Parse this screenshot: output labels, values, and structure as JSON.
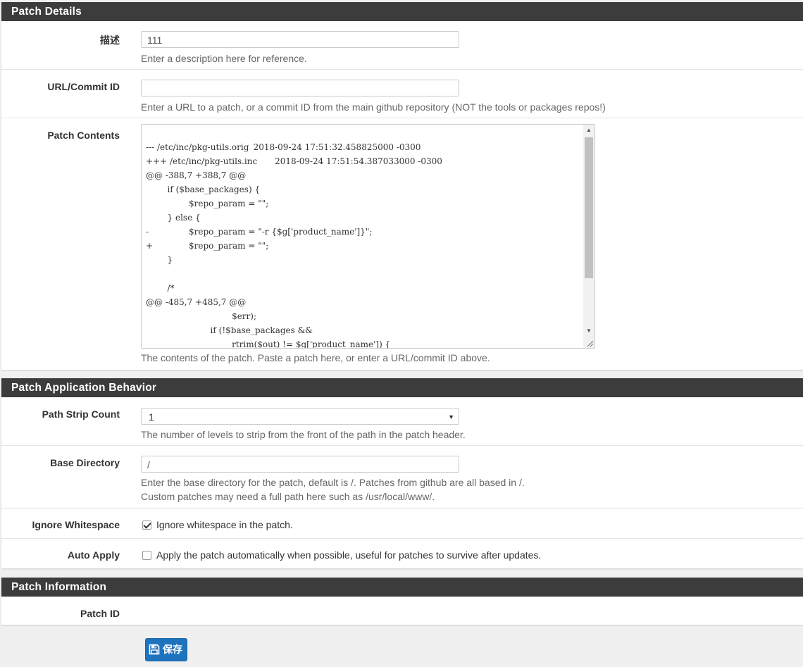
{
  "sections": {
    "patch_details": {
      "title": "Patch Details"
    },
    "application_behavior": {
      "title": "Patch Application Behavior"
    },
    "patch_information": {
      "title": "Patch Information"
    }
  },
  "description": {
    "label": "描述",
    "value": "111",
    "help": "Enter a description here for reference."
  },
  "url_commit": {
    "label": "URL/Commit ID",
    "value": "",
    "help": "Enter a URL to a patch, or a commit ID from the main github repository (NOT the tools or packages repos!)"
  },
  "patch_contents": {
    "label": "Patch Contents",
    "code": "--- /etc/inc/pkg-utils.orig\t2018-09-24 17:51:32.458825000 -0300\n+++ /etc/inc/pkg-utils.inc\t2018-09-24 17:51:54.387033000 -0300\n@@ -388,7 +388,7 @@\n \tif ($base_packages) {\n \t\t$repo_param = \"\";\n \t} else {\n-\t\t$repo_param = \"-r {$g['product_name']}\";\n+\t\t$repo_param = \"\";\n \t}\n \n \t/*\n@@ -485,7 +485,7 @@\n \t\t\t\t$err);\n \t\t\tif (!$base_packages &&\n \t\t\t\trtrim($out) != $g['product_name']) {",
    "help": "The contents of the patch. Paste a patch here, or enter a URL/commit ID above."
  },
  "path_strip": {
    "label": "Path Strip Count",
    "value": "1",
    "help": "The number of levels to strip from the front of the path in the patch header."
  },
  "base_directory": {
    "label": "Base Directory",
    "value": "/",
    "help_line1": "Enter the base directory for the patch, default is /. Patches from github are all based in /.",
    "help_line2": "Custom patches may need a full path here such as /usr/local/www/."
  },
  "ignore_whitespace": {
    "label": "Ignore Whitespace",
    "checked": true,
    "text": "Ignore whitespace in the patch."
  },
  "auto_apply": {
    "label": "Auto Apply",
    "checked": false,
    "text": "Apply the patch automatically when possible, useful for patches to survive after updates."
  },
  "patch_id": {
    "label": "Patch ID",
    "value": ""
  },
  "save_button": {
    "label": "保存",
    "icon": "save-icon",
    "color": "#1e73be"
  },
  "colors": {
    "heading_bg": "#3c3c3c",
    "page_bg": "#f0f0f0",
    "accent": "#1e73be"
  }
}
